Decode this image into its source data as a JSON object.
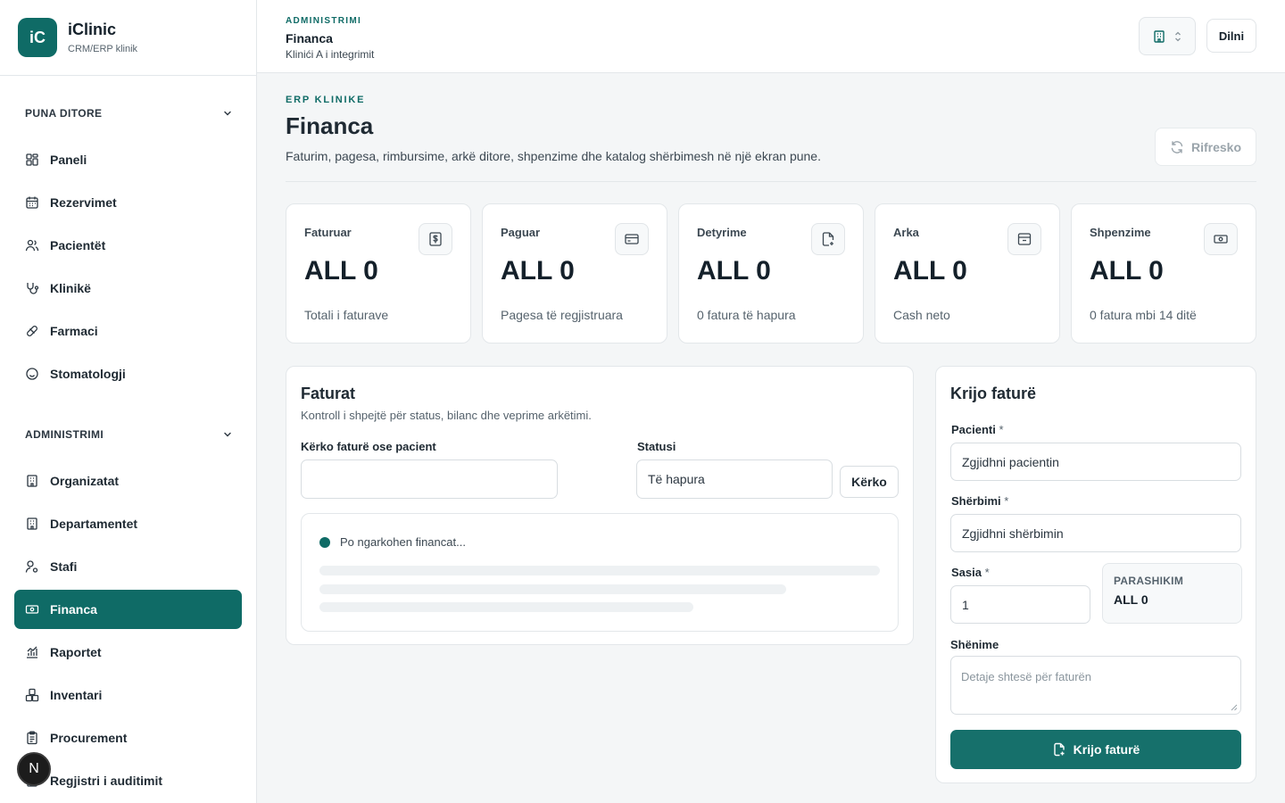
{
  "brand": {
    "logo": "iC",
    "name": "iClinic",
    "subtitle": "CRM/ERP klinik"
  },
  "sidebar": {
    "sections": [
      {
        "title": "PUNA DITORE",
        "items": [
          {
            "label": "Paneli",
            "icon": "dashboard-icon"
          },
          {
            "label": "Rezervimet",
            "icon": "calendar-icon"
          },
          {
            "label": "Pacientët",
            "icon": "users-icon"
          },
          {
            "label": "Klinikë",
            "icon": "stethoscope-icon"
          },
          {
            "label": "Farmaci",
            "icon": "pill-icon"
          },
          {
            "label": "Stomatologji",
            "icon": "smile-icon"
          }
        ]
      },
      {
        "title": "ADMINISTRIMI",
        "items": [
          {
            "label": "Organizatat",
            "icon": "building-icon"
          },
          {
            "label": "Departamentet",
            "icon": "building-icon"
          },
          {
            "label": "Stafi",
            "icon": "staff-icon"
          },
          {
            "label": "Financa",
            "icon": "banknote-icon",
            "active": true
          },
          {
            "label": "Raportet",
            "icon": "chart-icon"
          },
          {
            "label": "Inventari",
            "icon": "boxes-icon"
          },
          {
            "label": "Procurement",
            "icon": "clipboard-icon"
          },
          {
            "label": "Regjistri i auditimit",
            "icon": "audit-icon"
          }
        ]
      }
    ],
    "avatar_letter": "N"
  },
  "topbar": {
    "eyebrow": "ADMINISTRIMI",
    "title": "Financa",
    "subtitle": "Klinići A i integrimit",
    "login_label": "Dilni"
  },
  "page": {
    "eyebrow": "ERP KLINIKE",
    "title": "Financa",
    "description": "Faturim, pagesa, rimbursime, arkë ditore, shpenzime dhe katalog shërbimesh në një ekran pune.",
    "refresh_label": "Rifresko"
  },
  "stats": [
    {
      "label": "Faturuar",
      "value": "ALL 0",
      "hint": "Totali i faturave",
      "icon": "invoice-dollar-icon"
    },
    {
      "label": "Paguar",
      "value": "ALL 0",
      "hint": "Pagesa të regjistruara",
      "icon": "credit-card-icon"
    },
    {
      "label": "Detyrime",
      "value": "ALL 0",
      "hint": "0 fatura të hapura",
      "icon": "file-plus-icon"
    },
    {
      "label": "Arka",
      "value": "ALL 0",
      "hint": "Cash neto",
      "icon": "cash-drawer-icon"
    },
    {
      "label": "Shpenzime",
      "value": "ALL 0",
      "hint": "0 fatura mbi 14 ditë",
      "icon": "banknote-icon"
    }
  ],
  "invoices": {
    "title": "Faturat",
    "subtitle": "Kontroll i shpejtë për status, bilanc dhe veprime arkëtimi.",
    "search_label": "Kërko faturë ose pacient",
    "search_value": "",
    "status_label": "Statusi",
    "status_value": "Të hapura",
    "search_button": "Kërko",
    "loading_text": "Po ngarkohen financat..."
  },
  "create_invoice": {
    "title": "Krijo faturë",
    "patient_label": "Pacienti",
    "patient_value": "Zgjidhni pacientin",
    "service_label": "Shërbimi",
    "service_value": "Zgjidhni shërbimin",
    "quantity_label": "Sasia",
    "quantity_value": "1",
    "required_mark": "*",
    "preview_label": "PARASHIKIM",
    "preview_value": "ALL 0",
    "notes_label": "Shënime",
    "notes_placeholder": "Detaje shtesë për faturën",
    "submit_label": "Krijo faturë"
  },
  "colors": {
    "accent": "#0f6b66",
    "accent_button": "#16706b"
  }
}
